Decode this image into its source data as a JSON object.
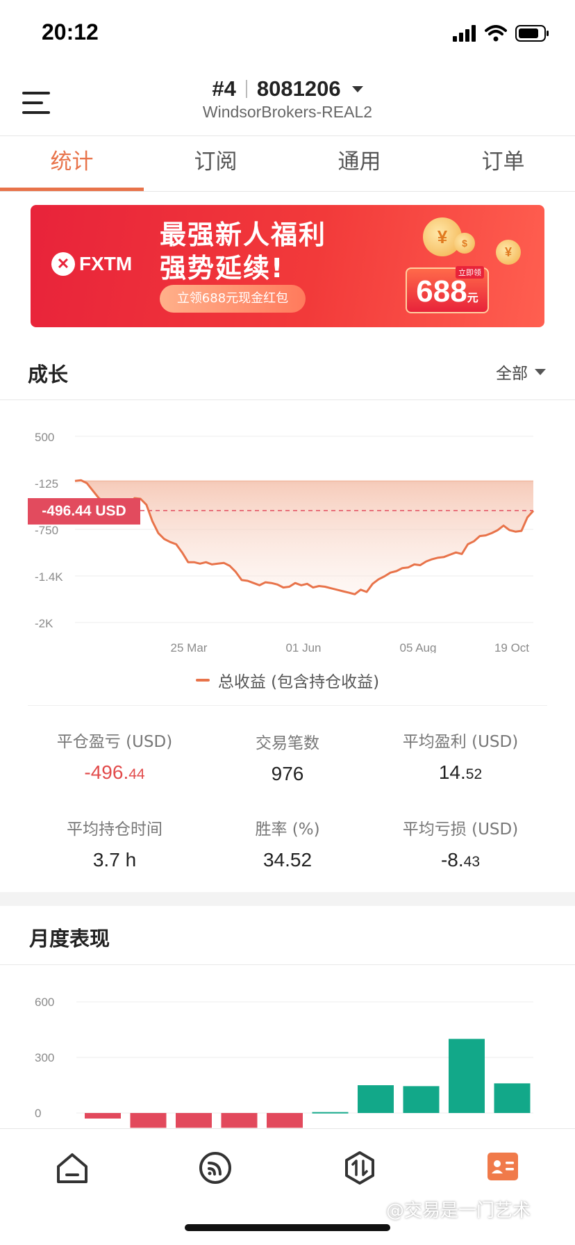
{
  "status_bar": {
    "time": "20:12"
  },
  "header": {
    "account_prefix": "#4",
    "account_number": "8081206",
    "server": "WindsorBrokers-REAL2"
  },
  "tabs": [
    {
      "label": "统计",
      "active": true
    },
    {
      "label": "订阅",
      "active": false
    },
    {
      "label": "通用",
      "active": false
    },
    {
      "label": "订单",
      "active": false
    }
  ],
  "banner": {
    "brand": "FXTM",
    "line1": "最强新人福利",
    "line2": "强势延续!",
    "pill": "立领688元现金红包",
    "amount": "688",
    "amount_unit": "元",
    "tag": "立即领"
  },
  "growth": {
    "title": "成长",
    "filter": "全部",
    "current_label": "-496.44 USD",
    "legend": "总收益 (包含持仓收益)"
  },
  "chart_data": [
    {
      "type": "area",
      "title": "成长",
      "y_ticks": [
        "500",
        "-125",
        "-750",
        "-1.4K",
        "-2K"
      ],
      "x_ticks": [
        "25 Mar",
        "01 Jun",
        "05 Aug",
        "19 Oct"
      ],
      "ylim": [
        -2000,
        500
      ],
      "reference_value": -496.44,
      "series": [
        {
          "name": "总收益 (包含持仓收益)",
          "color": "#e8734a",
          "values": [
            -100,
            -90,
            -130,
            -230,
            -330,
            -390,
            -420,
            -450,
            -500,
            -420,
            -330,
            -340,
            -420,
            -640,
            -800,
            -880,
            -920,
            -950,
            -1060,
            -1190,
            -1190,
            -1210,
            -1190,
            -1220,
            -1210,
            -1200,
            -1240,
            -1320,
            -1430,
            -1440,
            -1470,
            -1500,
            -1460,
            -1470,
            -1490,
            -1530,
            -1520,
            -1470,
            -1500,
            -1480,
            -1530,
            -1510,
            -1520,
            -1540,
            -1560,
            -1580,
            -1600,
            -1620,
            -1560,
            -1590,
            -1480,
            -1420,
            -1380,
            -1330,
            -1310,
            -1270,
            -1260,
            -1220,
            -1230,
            -1180,
            -1150,
            -1130,
            -1120,
            -1090,
            -1060,
            -1080,
            -950,
            -910,
            -840,
            -830,
            -800,
            -760,
            -700,
            -760,
            -780,
            -770,
            -590,
            -500
          ]
        }
      ]
    },
    {
      "type": "bar",
      "title": "月度表现",
      "y_ticks": [
        "600",
        "300",
        "0"
      ],
      "ylim": [
        -100,
        700
      ],
      "values": [
        -30,
        -80,
        -80,
        -80,
        -80,
        5,
        150,
        145,
        400,
        160
      ],
      "colors": {
        "positive": "#12a889",
        "negative": "#e2495c"
      }
    }
  ],
  "stats": [
    {
      "label": "平仓盈亏 (USD)",
      "int": "-496.",
      "dec": "44",
      "tone": "negative"
    },
    {
      "label": "交易笔数",
      "int": "976",
      "dec": "",
      "tone": "neutral"
    },
    {
      "label": "平均盈利 (USD)",
      "int": "14.",
      "dec": "52",
      "tone": "neutral"
    },
    {
      "label": "平均持仓时间",
      "int": "3.7 h",
      "dec": "",
      "tone": "neutral"
    },
    {
      "label": "胜率 (%)",
      "int": "34.52",
      "dec": "",
      "tone": "neutral"
    },
    {
      "label": "平均亏损 (USD)",
      "int": "-8.",
      "dec": "43",
      "tone": "neutral"
    }
  ],
  "monthly": {
    "title": "月度表现"
  },
  "bottom_nav": [
    {
      "icon": "home-icon",
      "active": false
    },
    {
      "icon": "signal-icon",
      "active": false
    },
    {
      "icon": "trade-icon",
      "active": false
    },
    {
      "icon": "profile-card-icon",
      "active": true
    }
  ],
  "watermark": "@交易是一门艺术",
  "colors": {
    "accent": "#e8734a",
    "negative": "#e24b4b",
    "positive": "#12a889"
  }
}
